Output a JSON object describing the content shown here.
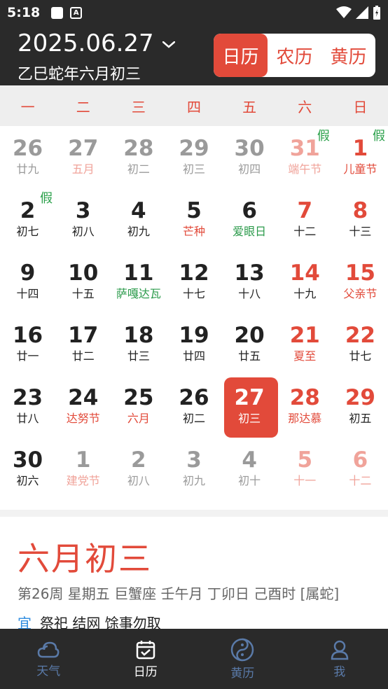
{
  "status": {
    "time": "5:18"
  },
  "header": {
    "date": "2025.06.27",
    "lunar": "乙巳蛇年六月初三",
    "modes": [
      "日历",
      "农历",
      "黄历"
    ]
  },
  "weekdays": [
    "一",
    "二",
    "三",
    "四",
    "五",
    "六",
    "日"
  ],
  "days": [
    [
      {
        "n": "26",
        "s": "廿九",
        "muted": true
      },
      {
        "n": "27",
        "s": "五月",
        "muted": true,
        "sc": "red"
      },
      {
        "n": "28",
        "s": "初二",
        "muted": true
      },
      {
        "n": "29",
        "s": "初三",
        "muted": true
      },
      {
        "n": "30",
        "s": "初四",
        "muted": true
      },
      {
        "n": "31",
        "s": "端午节",
        "muted": true,
        "weekend": true,
        "sc": "red",
        "tag": "假"
      },
      {
        "n": "1",
        "s": "儿童节",
        "weekend": true,
        "sc": "red",
        "tag": "假"
      }
    ],
    [
      {
        "n": "2",
        "s": "初七",
        "tag": "假"
      },
      {
        "n": "3",
        "s": "初八"
      },
      {
        "n": "4",
        "s": "初九"
      },
      {
        "n": "5",
        "s": "芒种",
        "sc": "red"
      },
      {
        "n": "6",
        "s": "爱眼日",
        "sc": "green"
      },
      {
        "n": "7",
        "s": "十二",
        "weekend": true
      },
      {
        "n": "8",
        "s": "十三",
        "weekend": true
      }
    ],
    [
      {
        "n": "9",
        "s": "十四"
      },
      {
        "n": "10",
        "s": "十五"
      },
      {
        "n": "11",
        "s": "萨嘎达瓦",
        "sc": "green"
      },
      {
        "n": "12",
        "s": "十七"
      },
      {
        "n": "13",
        "s": "十八"
      },
      {
        "n": "14",
        "s": "十九",
        "weekend": true
      },
      {
        "n": "15",
        "s": "父亲节",
        "weekend": true,
        "sc": "red"
      }
    ],
    [
      {
        "n": "16",
        "s": "廿一"
      },
      {
        "n": "17",
        "s": "廿二"
      },
      {
        "n": "18",
        "s": "廿三"
      },
      {
        "n": "19",
        "s": "廿四"
      },
      {
        "n": "20",
        "s": "廿五"
      },
      {
        "n": "21",
        "s": "夏至",
        "weekend": true,
        "sc": "red"
      },
      {
        "n": "22",
        "s": "廿七",
        "weekend": true
      }
    ],
    [
      {
        "n": "23",
        "s": "廿八"
      },
      {
        "n": "24",
        "s": "达努节",
        "sc": "red"
      },
      {
        "n": "25",
        "s": "六月",
        "sc": "red"
      },
      {
        "n": "26",
        "s": "初二"
      },
      {
        "n": "27",
        "s": "初三",
        "selected": true
      },
      {
        "n": "28",
        "s": "那达慕",
        "weekend": true,
        "sc": "red"
      },
      {
        "n": "29",
        "s": "初五",
        "weekend": true
      }
    ],
    [
      {
        "n": "30",
        "s": "初六"
      },
      {
        "n": "1",
        "s": "建党节",
        "muted": true,
        "sc": "red"
      },
      {
        "n": "2",
        "s": "初八",
        "muted": true
      },
      {
        "n": "3",
        "s": "初九",
        "muted": true
      },
      {
        "n": "4",
        "s": "初十",
        "muted": true
      },
      {
        "n": "5",
        "s": "十一",
        "muted": true,
        "weekend": true
      },
      {
        "n": "6",
        "s": "十二",
        "muted": true,
        "weekend": true
      }
    ]
  ],
  "detail": {
    "title": "六月初三",
    "info": "第26周  星期五  巨蟹座    壬午月 丁卯日 己酉时 [属蛇]",
    "yi_label": "宜",
    "yi_text": "祭祀 结网 馀事勿取"
  },
  "nav": [
    {
      "label": "天气",
      "icon": "cloud-icon"
    },
    {
      "label": "日历",
      "icon": "calendar-check-icon",
      "active": true
    },
    {
      "label": "黄历",
      "icon": "yin-yang-icon"
    },
    {
      "label": "我",
      "icon": "profile-icon"
    }
  ]
}
